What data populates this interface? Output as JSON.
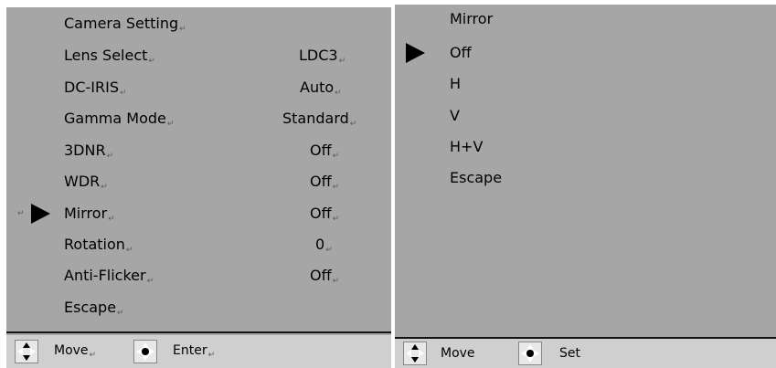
{
  "left_menu": {
    "title": "Camera Setting",
    "items": [
      {
        "label": "Lens Select",
        "value": "LDC3"
      },
      {
        "label": "DC-IRIS",
        "value": "Auto"
      },
      {
        "label": "Gamma Mode",
        "value": "Standard"
      },
      {
        "label": "3DNR",
        "value": "Off"
      },
      {
        "label": "WDR",
        "value": "Off"
      },
      {
        "label": "Mirror",
        "value": "Off",
        "selected": true
      },
      {
        "label": "Rotation",
        "value": "0"
      },
      {
        "label": "Anti-Flicker",
        "value": "Off"
      },
      {
        "label": "Escape",
        "value": ""
      }
    ],
    "footer": {
      "move_label": "Move",
      "enter_label": "Enter",
      "move_icon": "dpad-up-down-icon",
      "enter_icon": "dpad-center-icon"
    }
  },
  "right_menu": {
    "title": "Mirror",
    "options": [
      "Off",
      "H",
      "V",
      "H+V",
      "Escape"
    ],
    "selected_index": 0,
    "footer": {
      "move_label": "Move",
      "set_label": "Set",
      "move_icon": "dpad-up-down-icon",
      "set_icon": "dpad-center-icon"
    }
  },
  "colors": {
    "panel_bg": "#a6a6a6",
    "footer_bg": "#cfcfcf",
    "text": "#000000",
    "pointer": "#000000"
  },
  "edit_mark": "↵"
}
